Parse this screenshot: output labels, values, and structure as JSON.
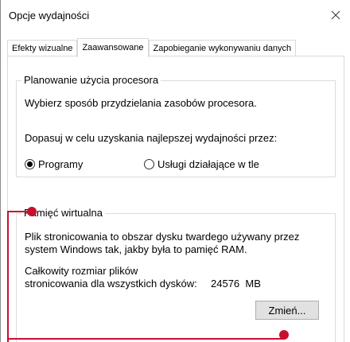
{
  "window": {
    "title": "Opcje wydajności",
    "close_glyph": "✕"
  },
  "tabs": [
    {
      "label": "Efekty wizualne"
    },
    {
      "label": "Zaawansowane"
    },
    {
      "label": "Zapobieganie wykonywaniu danych"
    }
  ],
  "cpu": {
    "group_title": "Planowanie użycia procesora",
    "description": "Wybierz sposób przydzielania zasobów procesora.",
    "prompt": "Dopasuj w celu uzyskania najlepszej wydajności przez:",
    "option_programs": "Programy",
    "option_services": "Usługi działające w tle",
    "selected": "Programy"
  },
  "vmem": {
    "group_title": "Pamięć wirtualna",
    "desc_line1": "Plik stronicowania to obszar dysku twardego używany przez",
    "desc_line2": "system Windows tak, jakby była to pamięć RAM.",
    "total_line1": "Całkowity rozmiar plików",
    "total_line2": "stronicowania dla wszystkich dysków:",
    "total_value": "24576  MB",
    "change_button": "Zmień..."
  },
  "colors": {
    "callout": "#c8102e"
  }
}
